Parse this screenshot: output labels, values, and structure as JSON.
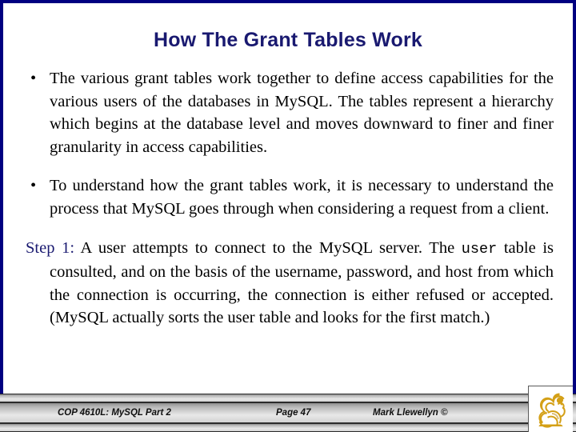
{
  "slide": {
    "title": "How The Grant Tables Work",
    "accent_color": "#191970",
    "frame_color": "#000080",
    "background_color": "#ffffff"
  },
  "content": {
    "bullets": [
      {
        "marker": "•",
        "text": "The various grant tables work together to define access capabilities for the various users of the databases in MySQL. The tables represent a hierarchy which begins at the database level and moves downward to finer and finer granularity in access capabilities."
      },
      {
        "marker": "•",
        "text": "To understand how the grant tables work, it is necessary to understand the process that MySQL goes through when considering a request from a client."
      }
    ],
    "step": {
      "label": "Step 1:",
      "text_before_code": " A user attempts to connect to the MySQL server.  The ",
      "code": "user",
      "text_after_code": " table is consulted, and on the basis of the username, password, and host from which the connection is occurring, the connection is either refused or accepted.  (MySQL actually sorts the user table and looks for the first match.)"
    }
  },
  "footer": {
    "course": "COP 4610L: MySQL Part 2",
    "page": "Page 47",
    "author": "Mark Llewellyn ©",
    "logo_name": "ucf-pegasus-logo",
    "logo_color": "#d4a017"
  }
}
